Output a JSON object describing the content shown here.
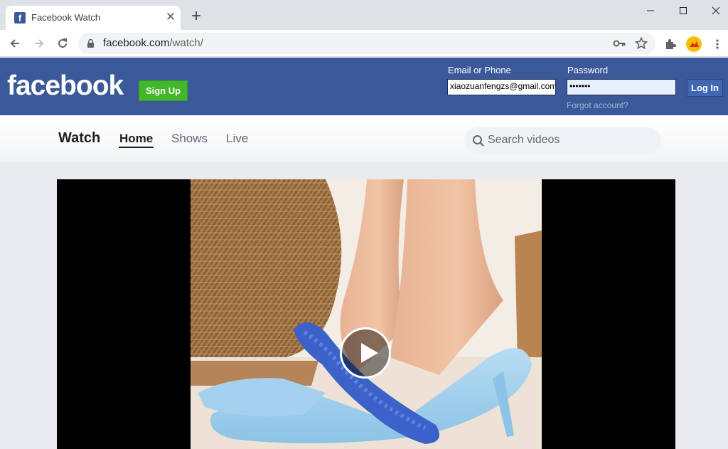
{
  "browser": {
    "tab_title": "Facebook Watch",
    "favicon_letter": "f",
    "tab_close": "✕",
    "new_tab": "+",
    "url_domain": "facebook.com",
    "url_path": "/watch/"
  },
  "header": {
    "logo": "facebook",
    "signup_label": "Sign Up",
    "email_label": "Email or Phone",
    "email_value": "xiaozuanfengzs@gmail.com",
    "password_label": "Password",
    "password_value": "•••••••",
    "login_label": "Log In",
    "forgot_label": "Forgot account?"
  },
  "watch_nav": {
    "title": "Watch",
    "tabs": [
      {
        "label": "Home"
      },
      {
        "label": "Shows"
      },
      {
        "label": "Live"
      }
    ],
    "search_placeholder": "Search videos"
  },
  "colors": {
    "fb_blue": "#3b5998",
    "signup_green": "#42b72a",
    "chrome_tabstrip": "#dee1e6"
  }
}
